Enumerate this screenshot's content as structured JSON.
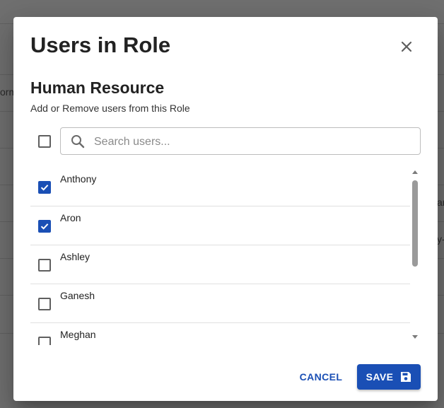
{
  "background": {
    "fragments": [
      "orm",
      "ar",
      "y-"
    ]
  },
  "dialog": {
    "title": "Users in Role",
    "close_icon": "close-icon",
    "role_name": "Human Resource",
    "description": "Add or Remove users from this Role",
    "select_all_checked": false,
    "search": {
      "placeholder": "Search users...",
      "value": "",
      "icon": "search-icon"
    },
    "users": [
      {
        "name": "Anthony",
        "checked": true
      },
      {
        "name": "Aron",
        "checked": true
      },
      {
        "name": "Ashley",
        "checked": false
      },
      {
        "name": "Ganesh",
        "checked": false
      },
      {
        "name": "Meghan",
        "checked": false
      }
    ],
    "cancel_label": "CANCEL",
    "save_label": "SAVE",
    "save_icon": "save-icon"
  },
  "colors": {
    "primary": "#1a4fb5",
    "overlay": "#707070"
  }
}
